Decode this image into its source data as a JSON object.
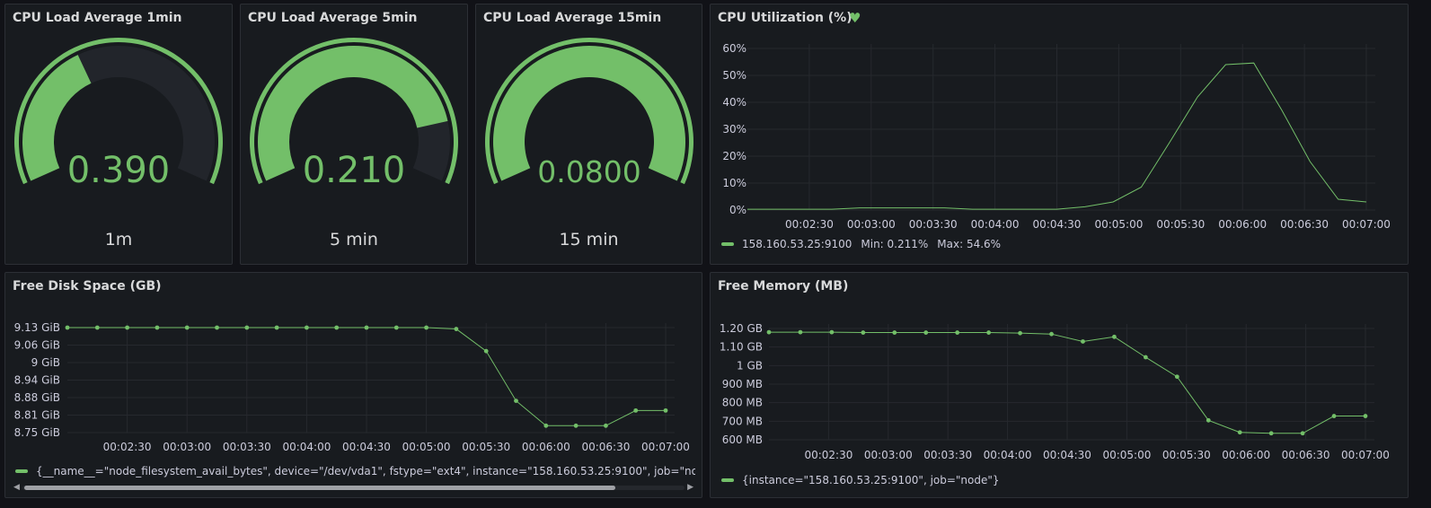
{
  "gauges": [
    {
      "title": "CPU Load Average 1min",
      "value": 0.39,
      "value_text": "0.390",
      "unit": "1m",
      "min": 0,
      "max": 1
    },
    {
      "title": "CPU Load Average 5min",
      "value": 0.21,
      "value_text": "0.210",
      "unit": "5 min",
      "min": 0,
      "max": 0.25
    },
    {
      "title": "CPU Load Average 15min",
      "value": 0.08,
      "value_text": "0.0800",
      "unit": "15 min",
      "min": 0,
      "max": 0.08
    }
  ],
  "colors": {
    "series": "#73bf69",
    "gauge_track": "#22252b",
    "background": "#111217",
    "panel": "#181b1f"
  },
  "icons": {
    "cpu_util_heart": "heart-icon"
  },
  "cpu_panel": {
    "title": "CPU Utilization (%)",
    "legend": {
      "series": "158.160.53.25:9100",
      "min": "Min: 0.211%",
      "max": "Max: 54.6%"
    }
  },
  "disk_panel": {
    "title": "Free Disk Space (GB)",
    "legend": {
      "series": "{__name__=\"node_filesystem_avail_bytes\", device=\"/dev/vda1\", fstype=\"ext4\", instance=\"158.160.53.25:9100\", job=\"node\", mc"
    }
  },
  "mem_panel": {
    "title": "Free Memory (MB)",
    "legend": {
      "series": "{instance=\"158.160.53.25:9100\", job=\"node\"}"
    }
  },
  "chart_data": [
    {
      "type": "line",
      "title": "CPU Utilization (%)",
      "x_ticks": [
        "00:02:30",
        "00:03:00",
        "00:03:30",
        "00:04:00",
        "00:04:30",
        "00:05:00",
        "00:05:30",
        "00:06:00",
        "00:06:30",
        "00:07:00"
      ],
      "y_ticks": [
        "0%",
        "10%",
        "20%",
        "30%",
        "40%",
        "50%",
        "60%"
      ],
      "ylim": [
        0,
        60
      ],
      "grid": true,
      "points_visible": false,
      "x": [
        "00:02:00",
        "00:02:15",
        "00:02:30",
        "00:02:45",
        "00:03:00",
        "00:03:15",
        "00:03:30",
        "00:03:45",
        "00:04:00",
        "00:04:15",
        "00:04:30",
        "00:04:45",
        "00:05:00",
        "00:05:15",
        "00:05:30",
        "00:05:45",
        "00:06:00",
        "00:06:15",
        "00:06:30",
        "00:06:45",
        "00:07:00"
      ],
      "series": [
        {
          "name": "158.160.53.25:9100",
          "values": [
            0.3,
            0.3,
            0.3,
            0.3,
            0.8,
            0.8,
            0.8,
            0.8,
            0.3,
            0.3,
            0.3,
            0.3,
            1.2,
            3,
            8.5,
            25,
            42,
            54,
            54.6,
            37,
            18,
            4,
            3
          ]
        }
      ]
    },
    {
      "type": "line",
      "title": "Free Disk Space (GB)",
      "x_ticks": [
        "00:02:30",
        "00:03:00",
        "00:03:30",
        "00:04:00",
        "00:04:30",
        "00:05:00",
        "00:05:30",
        "00:06:00",
        "00:06:30",
        "00:07:00"
      ],
      "y_ticks": [
        "8.75 GiB",
        "8.81 GiB",
        "8.88 GiB",
        "8.94 GiB",
        "9 GiB",
        "9.06 GiB",
        "9.13 GiB"
      ],
      "ylim": [
        8.75,
        9.13
      ],
      "grid": true,
      "points_visible": true,
      "x": [
        "00:02:00",
        "00:02:15",
        "00:02:30",
        "00:02:45",
        "00:03:00",
        "00:03:15",
        "00:03:30",
        "00:03:45",
        "00:04:00",
        "00:04:15",
        "00:04:30",
        "00:04:45",
        "00:05:00",
        "00:05:15",
        "00:05:30",
        "00:05:45",
        "00:06:00",
        "00:06:15",
        "00:06:30",
        "00:06:45",
        "00:07:00"
      ],
      "series": [
        {
          "name": "{__name__=\"node_filesystem_avail_bytes\", device=\"/dev/vda1\", fstype=\"ext4\", instance=\"158.160.53.25:9100\", job=\"node\", mc",
          "values": [
            9.13,
            9.13,
            9.13,
            9.13,
            9.13,
            9.13,
            9.13,
            9.13,
            9.13,
            9.13,
            9.13,
            9.13,
            9.13,
            9.125,
            9.045,
            8.865,
            8.775,
            8.775,
            8.775,
            8.83,
            8.83
          ]
        }
      ]
    },
    {
      "type": "line",
      "title": "Free Memory (MB)",
      "x_ticks": [
        "00:02:30",
        "00:03:00",
        "00:03:30",
        "00:04:00",
        "00:04:30",
        "00:05:00",
        "00:05:30",
        "00:06:00",
        "00:06:30",
        "00:07:00"
      ],
      "y_ticks": [
        "600 MB",
        "700 MB",
        "800 MB",
        "900 MB",
        "1 GB",
        "1.10 GB",
        "1.20 GB"
      ],
      "ylim": [
        600,
        1200
      ],
      "grid": true,
      "points_visible": true,
      "x": [
        "00:02:00",
        "00:02:15",
        "00:02:30",
        "00:02:45",
        "00:03:00",
        "00:03:15",
        "00:03:30",
        "00:03:45",
        "00:04:00",
        "00:04:15",
        "00:04:30",
        "00:04:45",
        "00:05:00",
        "00:05:15",
        "00:05:30",
        "00:05:45",
        "00:06:00",
        "00:06:15",
        "00:06:30",
        "00:06:45",
        "00:07:00"
      ],
      "series": [
        {
          "name": "{instance=\"158.160.53.25:9100\", job=\"node\"}",
          "values": [
            1180,
            1180,
            1180,
            1178,
            1178,
            1178,
            1178,
            1178,
            1175,
            1170,
            1130,
            1155,
            1045,
            940,
            705,
            640,
            635,
            635,
            728,
            728
          ]
        }
      ]
    }
  ]
}
